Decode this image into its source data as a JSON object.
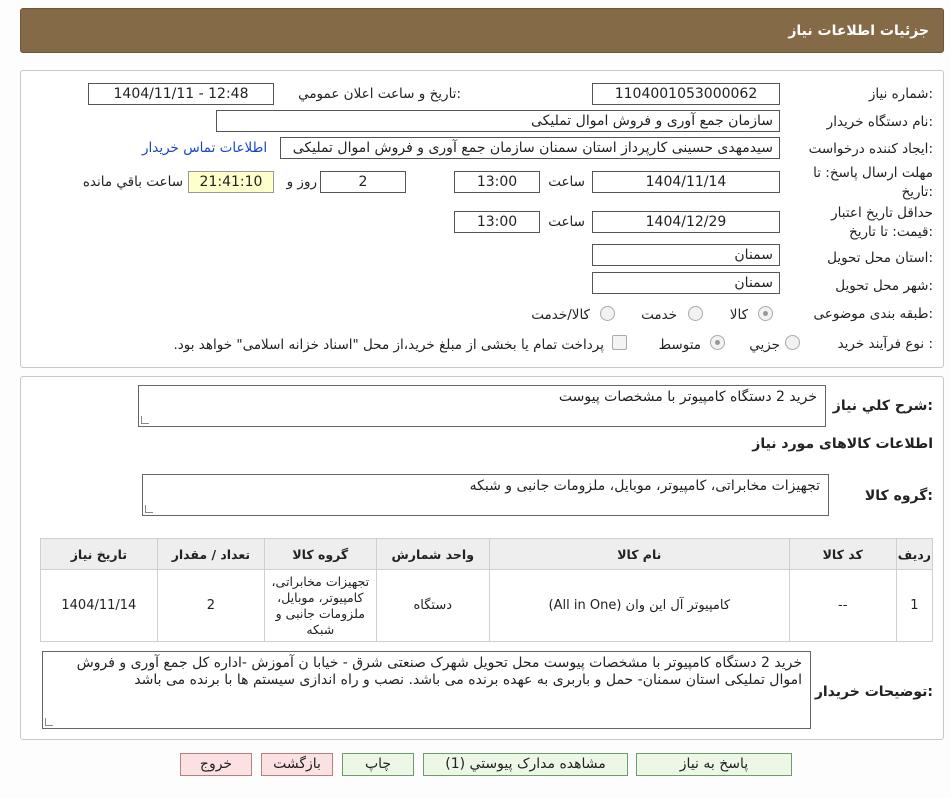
{
  "header": {
    "title": "جزئیات اطلاعات نیاز"
  },
  "form": {
    "need_number": {
      "label": "شماره نیاز:",
      "value": "1104001053000062"
    },
    "announce": {
      "label": "تاریخ و ساعت اعلان عمومي:",
      "value": "1404/11/11 - 12:48"
    },
    "buyer_org": {
      "label": "نام دستگاه خریدار:",
      "value": "سازمان جمع آوری و فروش اموال تملیکی"
    },
    "requester": {
      "label": "ایجاد کننده درخواست:",
      "value": "سیدمهدی حسینی کارپرداز استان سمنان سازمان جمع آوری و فروش اموال تملیکی",
      "contact_link": "اطلاعات تماس خریدار"
    },
    "reply_deadline": {
      "label_line1": "مهلت ارسال پاسخ: تا",
      "label_line2": "تاریخ:",
      "date": "1404/11/14",
      "time_label": "ساعت",
      "time": "13:00",
      "days": "2",
      "days_label": "روز و",
      "remaining": "21:41:10",
      "remaining_label": "ساعت باقي مانده"
    },
    "price_validity": {
      "label_line1": "حداقل تاریخ اعتبار",
      "label_line2": "قیمت: تا تاریخ:",
      "date": "1404/12/29",
      "time_label": "ساعت",
      "time": "13:00"
    },
    "delivery_province": {
      "label": "استان محل تحویل:",
      "value": "سمنان"
    },
    "delivery_city": {
      "label": "شهر محل تحویل:",
      "value": "سمنان"
    },
    "category": {
      "label": "طبقه بندی موضوعی:",
      "options": [
        "کالا",
        "خدمت",
        "کالا/خدمت"
      ],
      "selected": "کالا"
    },
    "purchase_type": {
      "label": "نوع فرآیند خرید :",
      "options": [
        "جزیي",
        "متوسط"
      ],
      "selected": "متوسط",
      "treasury_note": "پرداخت تمام یا بخشی از مبلغ خرید،از محل \"اسناد خزانه اسلامی\" خواهد بود."
    }
  },
  "summary": {
    "label": "شرح کلي نیاز:",
    "value": "خرید 2 دستگاه کامپیوتر با مشخصات پیوست"
  },
  "goods_section": {
    "title": "اطلاعات کالاهای مورد نیاز",
    "group_label": "گروه کالا:",
    "group_value": "تجهیزات مخابراتی، کامپیوتر، موبایل، ملزومات جانبی و شبکه"
  },
  "table": {
    "headers": [
      "ردیف",
      "کد کالا",
      "نام کالا",
      "واحد شمارش",
      "گروه کالا",
      "تعداد / مقدار",
      "تاریخ نیاز"
    ],
    "rows": [
      {
        "row": "1",
        "code": "--",
        "name": "کامپیوتر آل این وان (All in One)",
        "unit": "دستگاه",
        "group": "تجهیزات مخابراتی، کامپیوتر، موبایل، ملزومات جانبی و شبکه",
        "qty": "2",
        "date": "1404/11/14"
      }
    ]
  },
  "buyer_notes": {
    "label": "توضیحات خریدار:",
    "value": "خرید 2 دستگاه کامپیوتر با مشخصات پیوست محل تحویل شهرک صنعتی شرق - خیابا ن آموزش -اداره کل جمع آوری و فروش اموال تملیکی استان سمنان- حمل  و باربری به عهده برنده می باشد. نصب و راه اندازی سیستم ها با برنده می باشد"
  },
  "buttons": {
    "reply": "پاسخ به نیاز",
    "attachments": "مشاهده مدارک پیوستي (1)",
    "print": "چاپ",
    "back": "بازگشت",
    "exit": "خروج"
  },
  "watermark": {
    "text": "AriaTender.neT"
  },
  "colors": {
    "header_bg": "#846a47",
    "link": "#1a44c8",
    "button_bg": "#ecf7e6",
    "button_pink": "#fbe1e1"
  }
}
